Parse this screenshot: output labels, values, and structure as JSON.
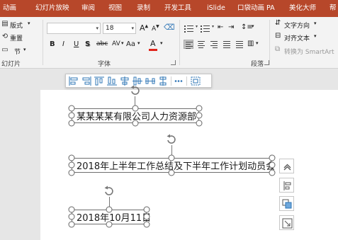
{
  "tabs": [
    "动画",
    "幻灯片放映",
    "审阅",
    "视图",
    "录制",
    "开发工具",
    "iSlide",
    "口袋动画 PA",
    "美化大师",
    "帮"
  ],
  "slides_group": {
    "layout_label": "版式",
    "reset_label": "重置",
    "section_label": "节",
    "group_label": "幻灯片"
  },
  "font_group": {
    "font_name": "",
    "font_size": "18",
    "grow_label": "A",
    "shrink_label": "A",
    "bold": "B",
    "italic": "I",
    "underline": "U",
    "shadow": "S",
    "strike": "abc",
    "spacing": "AV",
    "case": "Aa",
    "font_color": "A",
    "group_label": "字体"
  },
  "paragraph_group": {
    "text_direction": "文字方向",
    "align_text": "对齐文本",
    "smartart": "转换为 SmartArt",
    "group_label": "段落"
  },
  "text_boxes": [
    {
      "text": "某某某某有限公司人力资源部"
    },
    {
      "text": "2018年上半年工作总结及下半年工作计划动员会"
    },
    {
      "text": "2018年10月11日"
    }
  ],
  "colors": {
    "ribbon_tab_bg": "#b7472a",
    "ribbon_bg": "#f3f3f3",
    "workspace_bg": "#e6e6e6",
    "font_color_bar": "#e0241b"
  },
  "icons": {
    "float_toolbar": [
      "align-left-icon",
      "align-right-icon",
      "align-top-icon",
      "align-bottom-icon",
      "align-center-icon",
      "align-middle-icon",
      "distribute-horizontal-icon",
      "distribute-vertical-icon",
      "more-icon",
      "group-icon"
    ],
    "side_buttons": [
      "collapse-up-icon",
      "layout-options-icon",
      "bring-forward-icon",
      "send-backward-icon"
    ]
  }
}
